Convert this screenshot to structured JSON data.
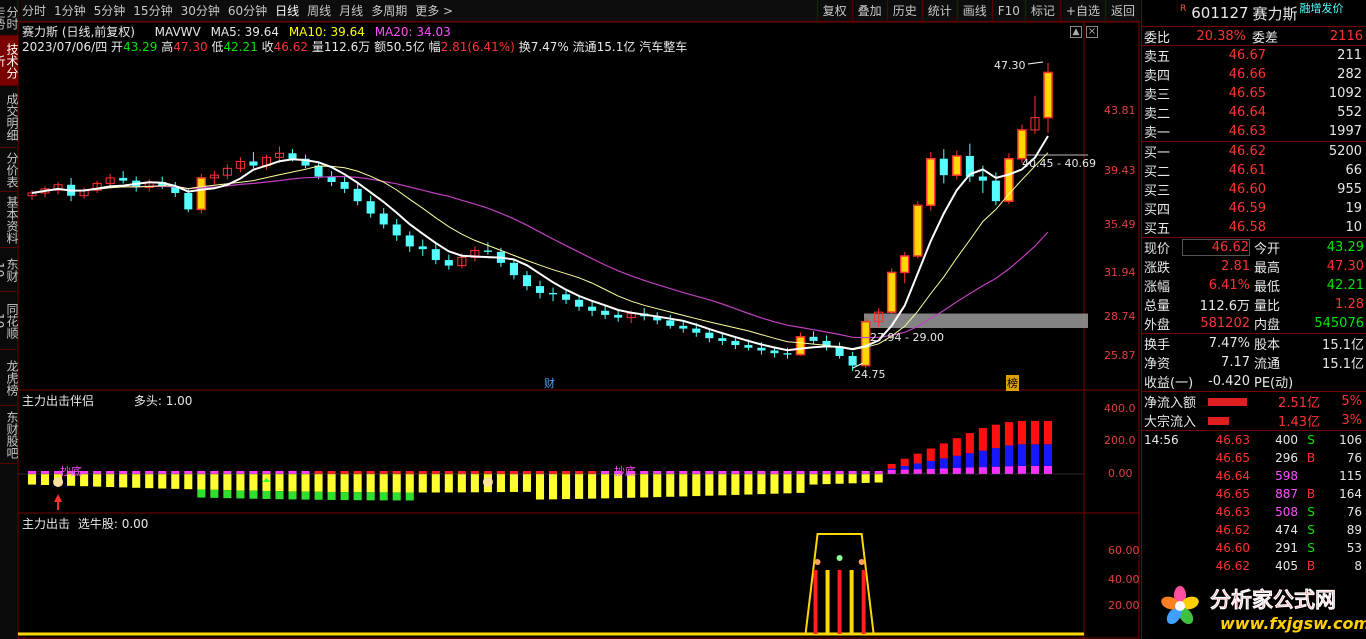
{
  "left_tabs": [
    "分时走势",
    "技术分析",
    "成交明细",
    "分价表",
    "基本资料",
    "东财10",
    "同花顺10",
    "龙虎榜",
    "东财股吧"
  ],
  "left_tab_active": 1,
  "toolbar": {
    "periods": [
      "分时",
      "1分钟",
      "5分钟",
      "15分钟",
      "30分钟",
      "60分钟",
      "日线",
      "周线",
      "月线",
      "多周期",
      "更多 >"
    ],
    "active_period": 6,
    "right_buttons": [
      "复权",
      "叠加",
      "历史",
      "统计",
      "画线",
      "F10",
      "标记",
      "+自选",
      "返回"
    ]
  },
  "header": {
    "stock_line": "赛力斯 (日线,前复权)",
    "ma_label": "MAVWV",
    "ma5": "MA5: 39.64",
    "ma10": "MA10: 39.64",
    "ma20": "MA20: 34.03",
    "date": "2023/07/06/四",
    "open_label": "开",
    "open": "43.29",
    "high_label": "高",
    "high": "47.30",
    "low_label": "低",
    "low": "42.21",
    "close_label": "收",
    "close": "46.62",
    "vol_label": "量",
    "vol": "112.6万",
    "amt_label": "额",
    "amt": "50.5亿",
    "chg_label": "幅",
    "chg": "2.81(6.41%)",
    "turnover": "换7.47%",
    "float": "流通15.1亿",
    "sector": "汽车整车"
  },
  "annotations": {
    "high_mark": "47.30",
    "range_upper": "40.45 - 40.69",
    "range_lower": "27.94 - 29.00",
    "low_mark": "24.75",
    "cai_tag": "财",
    "bang_tag": "榜",
    "dibottom_1": "抄底",
    "dibottom_2": "抄底"
  },
  "panel2": {
    "title": "主力出击伴侣",
    "value_label": "多头: 1.00",
    "axis": [
      "400.0",
      "200.0",
      "0.00"
    ]
  },
  "panel3": {
    "title": "主力出击",
    "value_label": "选牛股: 0.00",
    "axis": [
      "60.00",
      "40.00",
      "20.00"
    ]
  },
  "chart_data": {
    "type": "candlestick",
    "title": "赛力斯 (日线,前复权)",
    "y_axis_ticks": [
      43.81,
      39.43,
      35.49,
      31.94,
      28.74,
      25.87
    ],
    "ylim": [
      24.0,
      47.8
    ],
    "candles": [
      [
        37.6,
        38.0,
        37.3,
        37.8
      ],
      [
        37.8,
        38.3,
        37.5,
        38.1
      ],
      [
        38.0,
        38.6,
        37.7,
        38.4
      ],
      [
        38.4,
        38.9,
        37.2,
        37.6
      ],
      [
        37.6,
        38.2,
        37.4,
        38.0
      ],
      [
        38.0,
        38.7,
        37.8,
        38.5
      ],
      [
        38.5,
        39.2,
        38.2,
        38.9
      ],
      [
        38.9,
        39.4,
        38.5,
        38.7
      ],
      [
        38.7,
        39.0,
        37.9,
        38.2
      ],
      [
        38.2,
        38.8,
        37.9,
        38.6
      ],
      [
        38.6,
        39.0,
        38.1,
        38.3
      ],
      [
        38.3,
        38.6,
        37.5,
        37.8
      ],
      [
        37.8,
        38.1,
        36.4,
        36.6
      ],
      [
        36.6,
        39.2,
        36.3,
        38.9
      ],
      [
        38.9,
        39.4,
        38.4,
        39.1
      ],
      [
        39.1,
        39.9,
        38.8,
        39.6
      ],
      [
        39.6,
        40.4,
        39.3,
        40.1
      ],
      [
        40.1,
        40.8,
        39.6,
        39.8
      ],
      [
        39.8,
        40.6,
        39.5,
        40.4
      ],
      [
        40.4,
        41.2,
        40.0,
        40.7
      ],
      [
        40.7,
        41.0,
        40.1,
        40.3
      ],
      [
        40.3,
        40.6,
        39.6,
        39.8
      ],
      [
        39.8,
        40.1,
        38.8,
        39.0
      ],
      [
        39.0,
        39.4,
        38.3,
        38.6
      ],
      [
        38.6,
        39.0,
        37.8,
        38.1
      ],
      [
        38.1,
        38.5,
        36.9,
        37.2
      ],
      [
        37.2,
        37.6,
        36.0,
        36.3
      ],
      [
        36.3,
        36.7,
        35.2,
        35.5
      ],
      [
        35.5,
        35.9,
        34.3,
        34.7
      ],
      [
        34.7,
        35.0,
        33.5,
        33.9
      ],
      [
        33.9,
        34.4,
        33.2,
        33.7
      ],
      [
        33.7,
        34.1,
        32.6,
        32.9
      ],
      [
        32.9,
        33.3,
        32.2,
        32.5
      ],
      [
        32.5,
        33.4,
        32.3,
        33.1
      ],
      [
        33.1,
        33.9,
        32.8,
        33.6
      ],
      [
        33.6,
        34.2,
        33.3,
        33.5
      ],
      [
        33.5,
        33.8,
        32.4,
        32.7
      ],
      [
        32.7,
        33.0,
        31.5,
        31.8
      ],
      [
        31.8,
        32.1,
        30.7,
        31.0
      ],
      [
        31.0,
        31.4,
        30.1,
        30.5
      ],
      [
        30.5,
        30.9,
        29.9,
        30.4
      ],
      [
        30.4,
        30.8,
        29.7,
        30.0
      ],
      [
        30.0,
        30.3,
        29.2,
        29.5
      ],
      [
        29.5,
        29.9,
        28.8,
        29.2
      ],
      [
        29.2,
        29.6,
        28.6,
        28.9
      ],
      [
        28.9,
        29.3,
        28.4,
        28.7
      ],
      [
        28.7,
        29.2,
        28.3,
        29.0
      ],
      [
        29.0,
        29.4,
        28.5,
        28.8
      ],
      [
        28.8,
        29.1,
        28.2,
        28.5
      ],
      [
        28.5,
        28.9,
        27.9,
        28.1
      ],
      [
        28.1,
        28.5,
        27.6,
        27.9
      ],
      [
        27.9,
        28.3,
        27.3,
        27.6
      ],
      [
        27.6,
        27.9,
        26.9,
        27.2
      ],
      [
        27.2,
        27.6,
        26.7,
        27.0
      ],
      [
        27.0,
        27.3,
        26.4,
        26.7
      ],
      [
        26.7,
        27.1,
        26.3,
        26.5
      ],
      [
        26.5,
        26.9,
        26.0,
        26.3
      ],
      [
        26.3,
        26.6,
        25.8,
        26.1
      ],
      [
        26.1,
        26.5,
        25.7,
        26.0
      ],
      [
        26.0,
        27.6,
        25.9,
        27.3
      ],
      [
        27.3,
        27.7,
        26.8,
        27.0
      ],
      [
        27.0,
        27.4,
        26.3,
        26.6
      ],
      [
        26.6,
        26.9,
        25.7,
        25.9
      ],
      [
        25.9,
        26.2,
        24.8,
        25.2
      ],
      [
        25.2,
        28.7,
        25.0,
        28.4
      ],
      [
        28.4,
        29.4,
        28.0,
        29.1
      ],
      [
        29.1,
        32.3,
        29.0,
        32.0
      ],
      [
        32.0,
        33.5,
        31.2,
        33.2
      ],
      [
        33.2,
        37.2,
        33.0,
        36.9
      ],
      [
        36.9,
        40.8,
        36.5,
        40.3
      ],
      [
        40.3,
        41.0,
        38.5,
        39.1
      ],
      [
        39.1,
        40.9,
        38.8,
        40.5
      ],
      [
        40.5,
        41.4,
        38.6,
        39.0
      ],
      [
        39.0,
        39.8,
        37.8,
        38.7
      ],
      [
        38.7,
        39.3,
        36.9,
        37.2
      ],
      [
        37.2,
        40.7,
        37.0,
        40.3
      ],
      [
        40.3,
        42.8,
        40.0,
        42.4
      ],
      [
        42.4,
        44.9,
        42.1,
        43.3
      ],
      [
        43.3,
        47.3,
        42.2,
        46.6
      ]
    ],
    "ma5_label": "MA5",
    "ma10_label": "MA10",
    "ma20_label": "MA20",
    "panel2_series": [
      {
        "name": "多头",
        "type": "bar",
        "values_note": "histogram"
      }
    ],
    "panel2_ylim": [
      -60,
      420
    ],
    "panel3_ylim": [
      0,
      80
    ]
  },
  "quote": {
    "code": "601127",
    "name": "赛力斯",
    "badge": "R",
    "subtitle": "融增发价",
    "weibi_label": "委比",
    "weibi": "20.38%",
    "weicha_label": "委差",
    "weicha": "2116",
    "sells": [
      {
        "label": "卖五",
        "price": "46.67",
        "vol": "211"
      },
      {
        "label": "卖四",
        "price": "46.66",
        "vol": "282"
      },
      {
        "label": "卖三",
        "price": "46.65",
        "vol": "1092"
      },
      {
        "label": "卖二",
        "price": "46.64",
        "vol": "552"
      },
      {
        "label": "卖一",
        "price": "46.63",
        "vol": "1997"
      }
    ],
    "buys": [
      {
        "label": "买一",
        "price": "46.62",
        "vol": "5200"
      },
      {
        "label": "买二",
        "price": "46.61",
        "vol": "66"
      },
      {
        "label": "买三",
        "price": "46.60",
        "vol": "955"
      },
      {
        "label": "买四",
        "price": "46.59",
        "vol": "19"
      },
      {
        "label": "买五",
        "price": "46.58",
        "vol": "10"
      }
    ],
    "stats": [
      {
        "l1": "现价",
        "v1": "46.62",
        "c1": "red",
        "l2": "今开",
        "v2": "43.29",
        "c2": "green"
      },
      {
        "l1": "涨跌",
        "v1": "2.81",
        "c1": "red",
        "l2": "最高",
        "v2": "47.30",
        "c2": "red"
      },
      {
        "l1": "涨幅",
        "v1": "6.41%",
        "c1": "red",
        "l2": "最低",
        "v2": "42.21",
        "c2": "green"
      },
      {
        "l1": "总量",
        "v1": "112.6万",
        "c1": "white",
        "l2": "量比",
        "v2": "1.28",
        "c2": "red"
      },
      {
        "l1": "外盘",
        "v1": "581202",
        "c1": "red",
        "l2": "内盘",
        "v2": "545076",
        "c2": "green"
      }
    ],
    "stats2": [
      {
        "l1": "换手",
        "v1": "7.47%",
        "l2": "股本",
        "v2": "15.1亿"
      },
      {
        "l1": "净资",
        "v1": "7.17",
        "l2": "流通",
        "v2": "15.1亿"
      },
      {
        "l1": "收益(一)",
        "v1": "-0.420",
        "l2": "PE(动)",
        "v2": ""
      }
    ],
    "flow": [
      {
        "label": "净流入额",
        "value": "2.51亿",
        "pct": "5%"
      },
      {
        "label": "大宗流入",
        "value": "1.43亿",
        "pct": "3%"
      }
    ],
    "ticks_time": "14:56",
    "ticks": [
      {
        "price": "46.63",
        "vol": "400",
        "side": "S",
        "n": "106",
        "pc": "red",
        "vc": "white",
        "sc": "green"
      },
      {
        "price": "46.65",
        "vol": "296",
        "side": "B",
        "n": "76",
        "pc": "red",
        "vc": "white",
        "sc": "red"
      },
      {
        "price": "46.64",
        "vol": "598",
        "side": "",
        "n": "115",
        "pc": "red",
        "vc": "mag",
        "sc": "white"
      },
      {
        "price": "46.65",
        "vol": "887",
        "side": "B",
        "n": "164",
        "pc": "red",
        "vc": "mag",
        "sc": "red"
      },
      {
        "price": "46.63",
        "vol": "508",
        "side": "S",
        "n": "76",
        "pc": "red",
        "vc": "mag",
        "sc": "green"
      },
      {
        "price": "46.62",
        "vol": "474",
        "side": "S",
        "n": "89",
        "pc": "red",
        "vc": "white",
        "sc": "green"
      },
      {
        "price": "46.60",
        "vol": "291",
        "side": "S",
        "n": "53",
        "pc": "red",
        "vc": "white",
        "sc": "green"
      },
      {
        "price": "46.62",
        "vol": "405",
        "side": "B",
        "n": "8",
        "pc": "red",
        "vc": "white",
        "sc": "red"
      }
    ],
    "ticks_time_2": "14:5"
  },
  "watermark": {
    "cn": "分析家公式网",
    "url": "www.fxjgsw.com"
  }
}
